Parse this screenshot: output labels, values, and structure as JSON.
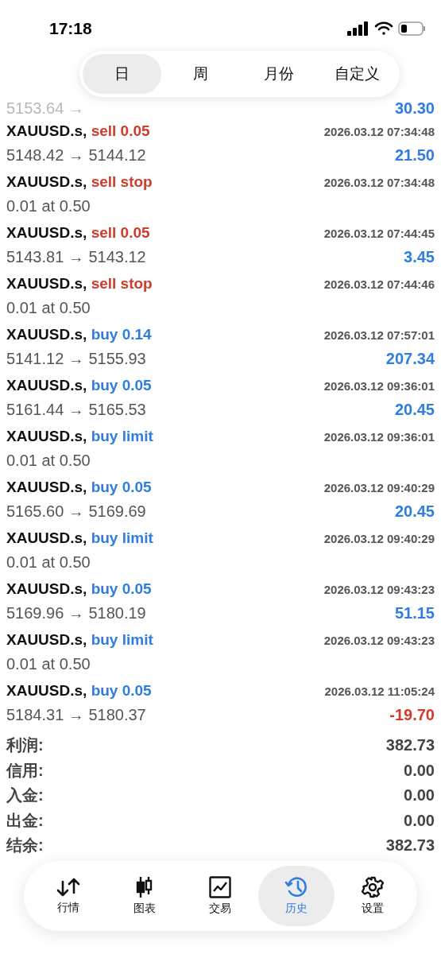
{
  "status_bar": {
    "time": "17:18"
  },
  "period_tabs": [
    {
      "label": "日",
      "selected": true
    },
    {
      "label": "周",
      "selected": false
    },
    {
      "label": "月份",
      "selected": false
    },
    {
      "label": "自定义",
      "selected": false
    }
  ],
  "partial_row": {
    "prices": "5153.64 →",
    "profit": "30.30",
    "color": "#2f7de1"
  },
  "deals": [
    {
      "symbol": "XAUUSD.s,",
      "order": "sell 0.05",
      "kind": "sell",
      "time": "2026.03.12 07:34:48",
      "prices": "5148.42 → 5144.12",
      "profit": "21.50",
      "color": "#2f7de1"
    },
    {
      "symbol": "XAUUSD.s,",
      "order": "sell stop",
      "kind": "sell",
      "time": "2026.03.12 07:34:48",
      "prices": "0.01 at 0.50"
    },
    {
      "symbol": "XAUUSD.s,",
      "order": "sell 0.05",
      "kind": "sell",
      "time": "2026.03.12 07:44:45",
      "prices": "5143.81 → 5143.12",
      "profit": "3.45",
      "color": "#2f7de1"
    },
    {
      "symbol": "XAUUSD.s,",
      "order": "sell stop",
      "kind": "sell",
      "time": "2026.03.12 07:44:46",
      "prices": "0.01 at 0.50"
    },
    {
      "symbol": "XAUUSD.s,",
      "order": "buy 0.14",
      "kind": "buy",
      "time": "2026.03.12 07:57:01",
      "prices": "5141.12 → 5155.93",
      "profit": "207.34",
      "color": "#2f7de1"
    },
    {
      "symbol": "XAUUSD.s,",
      "order": "buy 0.05",
      "kind": "buy",
      "time": "2026.03.12 09:36:01",
      "prices": "5161.44 → 5165.53",
      "profit": "20.45",
      "color": "#2f7de1"
    },
    {
      "symbol": "XAUUSD.s,",
      "order": "buy limit",
      "kind": "buy",
      "time": "2026.03.12 09:36:01",
      "prices": "0.01 at 0.50"
    },
    {
      "symbol": "XAUUSD.s,",
      "order": "buy 0.05",
      "kind": "buy",
      "time": "2026.03.12 09:40:29",
      "prices": "5165.60 → 5169.69",
      "profit": "20.45",
      "color": "#2f7de1"
    },
    {
      "symbol": "XAUUSD.s,",
      "order": "buy limit",
      "kind": "buy",
      "time": "2026.03.12 09:40:29",
      "prices": "0.01 at 0.50"
    },
    {
      "symbol": "XAUUSD.s,",
      "order": "buy 0.05",
      "kind": "buy",
      "time": "2026.03.12 09:43:23",
      "prices": "5169.96 → 5180.19",
      "profit": "51.15",
      "color": "#2f7de1"
    },
    {
      "symbol": "XAUUSD.s,",
      "order": "buy limit",
      "kind": "buy",
      "time": "2026.03.12 09:43:23",
      "prices": "0.01 at 0.50"
    },
    {
      "symbol": "XAUUSD.s,",
      "order": "buy 0.05",
      "kind": "buy",
      "time": "2026.03.12 11:05:24",
      "prices": "5184.31 → 5180.37",
      "profit": "-19.70",
      "color": "#d23a2c"
    }
  ],
  "summary": [
    {
      "label": "利润:",
      "value": "382.73"
    },
    {
      "label": "信用:",
      "value": "0.00"
    },
    {
      "label": "入金:",
      "value": "0.00"
    },
    {
      "label": "出金:",
      "value": "0.00"
    },
    {
      "label": "结余:",
      "value": "382.73"
    }
  ],
  "nav": [
    {
      "label": "行情",
      "kind": "quotes",
      "selected": false
    },
    {
      "label": "图表",
      "kind": "chart",
      "selected": false
    },
    {
      "label": "交易",
      "kind": "trade",
      "selected": false
    },
    {
      "label": "历史",
      "kind": "history",
      "selected": true
    },
    {
      "label": "设置",
      "kind": "settings",
      "selected": false
    }
  ]
}
